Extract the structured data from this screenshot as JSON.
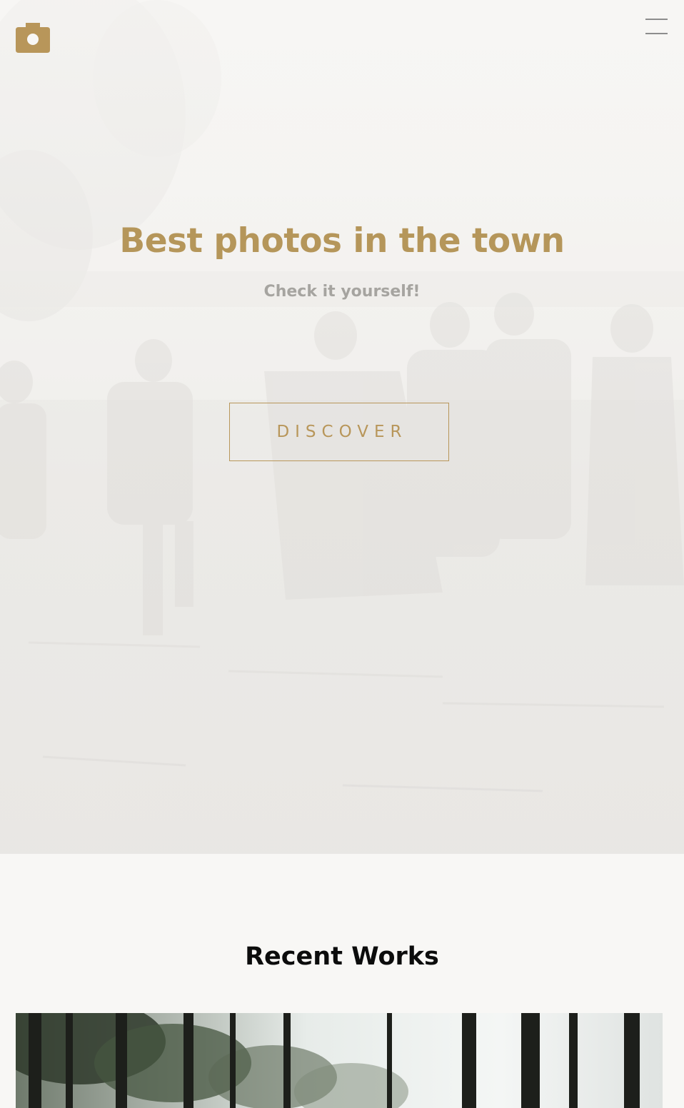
{
  "brand": {
    "logo_icon": "camera-icon",
    "accent_color": "#b8965a"
  },
  "nav": {
    "menu_icon": "hamburger-menu-icon"
  },
  "hero": {
    "title": "Best photos in the town",
    "subtitle": "Check it yourself!",
    "cta_label": "DISCOVER",
    "background": "faded vintage photo of people wading in a lake"
  },
  "recent": {
    "heading": "Recent Works",
    "items": [
      {
        "image": "forest-trees-photo"
      }
    ]
  }
}
